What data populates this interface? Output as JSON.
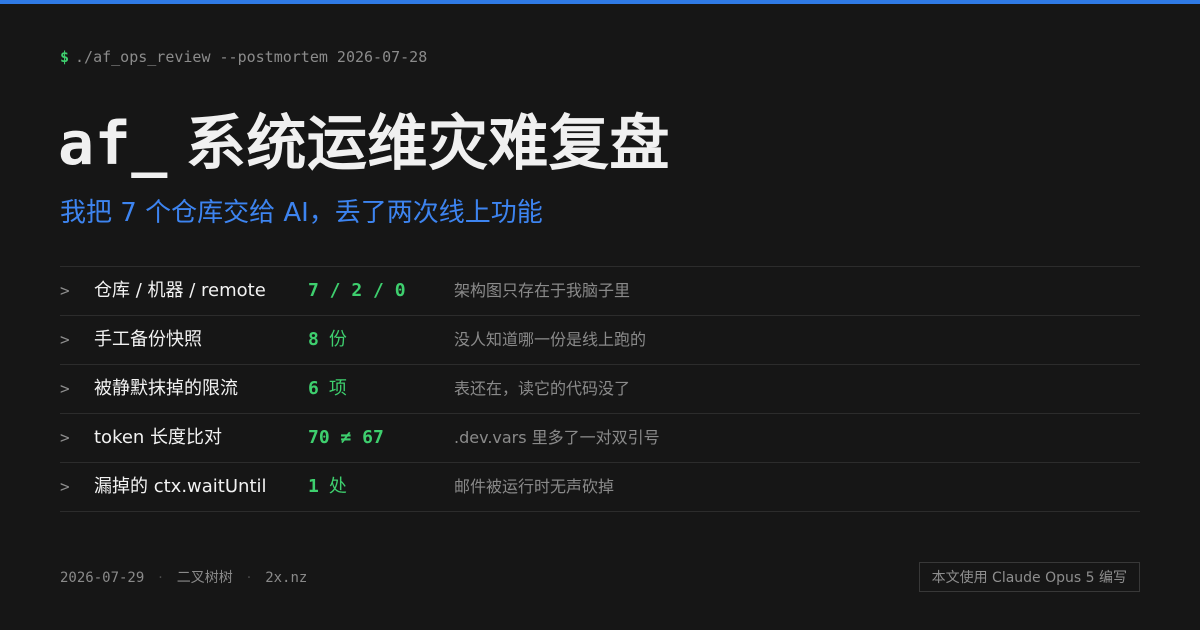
{
  "header": {
    "prompt_symbol": "$",
    "command": "./af_ops_review --postmortem 2026-07-28",
    "title_prefix": "af_",
    "title": "系统运维灾难复盘",
    "subtitle": "我把 7 个仓库交给 AI，丢了两次线上功能"
  },
  "rows": [
    {
      "chevron": ">",
      "label": "仓库 / 机器 / remote",
      "value": "7 / 2 / 0",
      "unit": "",
      "note": "架构图只存在于我脑子里"
    },
    {
      "chevron": ">",
      "label": "手工备份快照",
      "value": "8",
      "unit": "份",
      "note": "没人知道哪一份是线上跑的"
    },
    {
      "chevron": ">",
      "label": "被静默抹掉的限流",
      "value": "6",
      "unit": "项",
      "note": "表还在，读它的代码没了"
    },
    {
      "chevron": ">",
      "label": "token 长度比对",
      "value": "70 ≠ 67",
      "unit": "",
      "note": ".dev.vars 里多了一对双引号"
    },
    {
      "chevron": ">",
      "label": "漏掉的 ctx.waitUntil",
      "value": "1",
      "unit": "处",
      "note": "邮件被运行时无声砍掉"
    }
  ],
  "footer": {
    "date": "2026-07-29",
    "separator": "·",
    "author": "二叉树树",
    "site": "2x.nz",
    "badge": "本文使用 Claude Opus 5 编写"
  },
  "colors": {
    "background": "#161616",
    "accent_blue": "#2f7ae5",
    "accent_green": "#3ecf6e"
  }
}
